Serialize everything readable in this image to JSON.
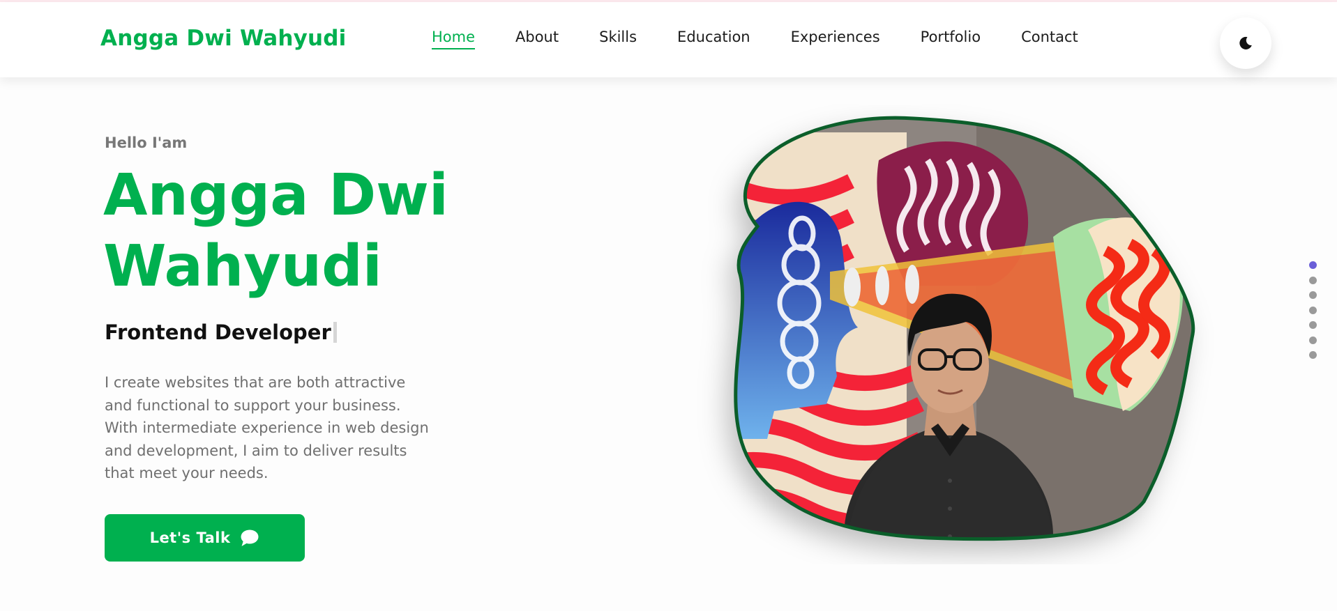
{
  "header": {
    "brand": "Angga Dwi Wahyudi",
    "nav": [
      {
        "label": "Home",
        "active": true
      },
      {
        "label": "About"
      },
      {
        "label": "Skills"
      },
      {
        "label": "Education"
      },
      {
        "label": "Experiences"
      },
      {
        "label": "Portfolio"
      },
      {
        "label": "Contact"
      }
    ],
    "theme_icon": "moon-icon"
  },
  "hero": {
    "greeting": "Hello I'am",
    "name": "Angga Dwi Wahyudi",
    "role": "Frontend Developer",
    "description": "I create websites that are both attractive and functional to support your business. With intermediate experience in web design and development, I aim to deliver results that meet your needs.",
    "cta_label": "Let's Talk",
    "cta_icon": "chat-bubble-icon",
    "photo": "profile-photo"
  },
  "section_dots": {
    "count": 7,
    "active_index": 0
  },
  "colors": {
    "accent": "#00b04f",
    "dot_active": "#6a5fd8",
    "dot": "#9a9a9a",
    "blob_border": "#0b5e2a"
  }
}
